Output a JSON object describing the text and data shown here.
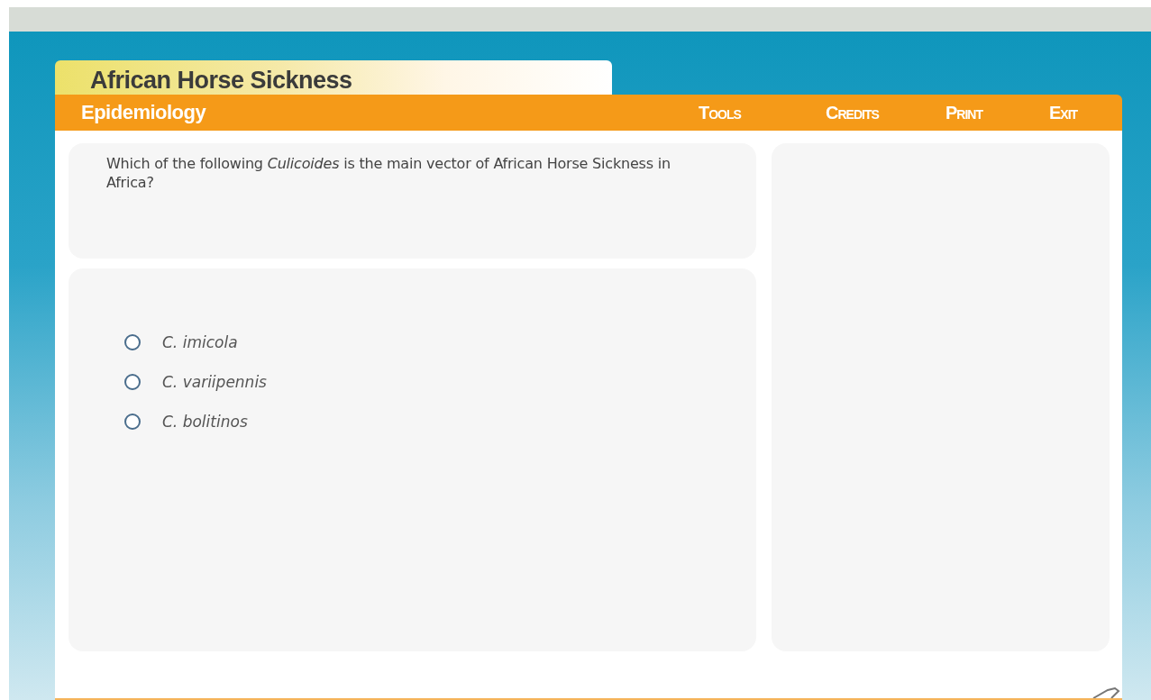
{
  "course_title": "African Horse Sickness",
  "section": "Epidemiology",
  "menu": [
    {
      "label": "Tools"
    },
    {
      "label": "Credits"
    },
    {
      "label": "Print"
    },
    {
      "label": "Exit"
    }
  ],
  "question": "Which of the following *Culicoides* is the main vector of African Horse Sickness in Africa?",
  "options": [
    {
      "label": "C. imicola",
      "selected": false
    },
    {
      "label": "C. variipennis",
      "selected": false
    },
    {
      "label": "C. bolitinos",
      "selected": false
    }
  ]
}
